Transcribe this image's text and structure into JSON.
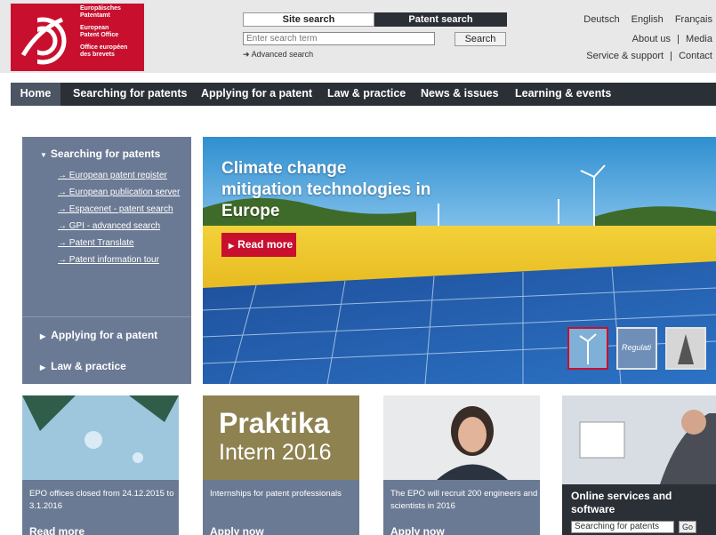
{
  "logo": {
    "text_lines": [
      "Europäisches",
      "Patentamt",
      "European",
      "Patent Office",
      "Office européen",
      "des brevets"
    ]
  },
  "search": {
    "tab_site": "Site search",
    "tab_patent": "Patent search",
    "active_tab": "Patent search",
    "placeholder": "Enter search term",
    "button": "Search",
    "advanced": "Advanced search"
  },
  "languages": [
    "Deutsch",
    "English",
    "Français"
  ],
  "utility_links": {
    "about": "About us",
    "media": "Media",
    "service": "Service & support",
    "contact": "Contact",
    "separator": "|"
  },
  "nav": [
    "Home",
    "Searching for patents",
    "Applying for a patent",
    "Law & practice",
    "News & issues",
    "Learning & events"
  ],
  "sidebar": {
    "heading": "Searching for patents",
    "links": [
      "European patent register",
      "European publication server",
      "Espacenet - patent search",
      "GPI - advanced search",
      "Patent Translate",
      "Patent information tour"
    ],
    "sections": [
      "Applying for a patent",
      "Law & practice"
    ]
  },
  "hero": {
    "title_lines": [
      "Climate change",
      "mitigation technologies in",
      "Europe"
    ],
    "button": "Read more",
    "thumb_label": "Regulati"
  },
  "cards": [
    {
      "text": "EPO offices closed from 24.12.2015 to 3.1.2016",
      "link": "Read more"
    },
    {
      "image_title": "Praktika",
      "image_subtitle": "Intern 2016",
      "text": "Internships for patent professionals",
      "link": "Apply now"
    },
    {
      "text": "The EPO will recruit 200 engineers and scientists in 2016",
      "link": "Apply now"
    }
  ],
  "online": {
    "title": "Online services and software",
    "select_value": "Searching for patents",
    "go": "Go"
  },
  "colors": {
    "brand_red": "#c8102e",
    "dark_nav": "#2b2f36",
    "slate_panel": "#6b7a94"
  }
}
